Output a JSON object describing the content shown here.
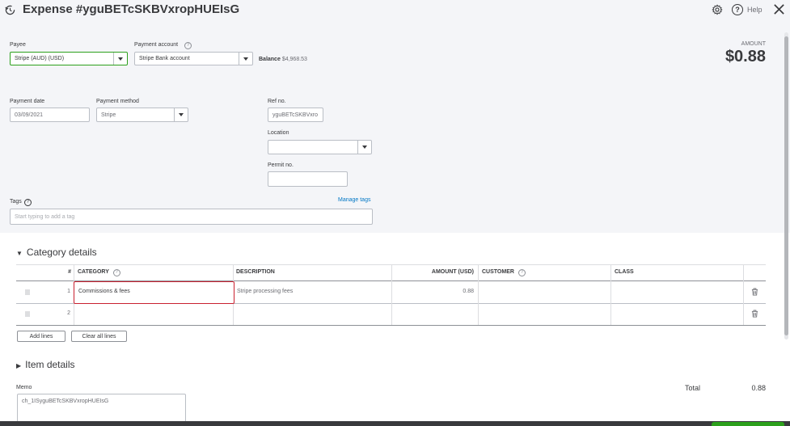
{
  "header": {
    "title": "Expense #yguBETcSKBVxropHUEIsG",
    "help_label": "Help"
  },
  "payee": {
    "label": "Payee",
    "value": "Stripe (AUD) (USD)"
  },
  "payment_account": {
    "label": "Payment account",
    "value": "Stripe Bank account"
  },
  "balance": {
    "label": "Balance",
    "value": "$4,968.53"
  },
  "amount": {
    "label": "AMOUNT",
    "value": "$0.88"
  },
  "payment_date": {
    "label": "Payment date",
    "value": "03/09/2021"
  },
  "payment_method": {
    "label": "Payment method",
    "value": "Stripe"
  },
  "ref_no": {
    "label": "Ref no.",
    "value": "yguBETcSKBVxro"
  },
  "location": {
    "label": "Location",
    "value": ""
  },
  "permit_no": {
    "label": "Permit no.",
    "value": ""
  },
  "tags": {
    "label": "Tags",
    "placeholder": "Start typing to add a tag",
    "manage_label": "Manage tags"
  },
  "category_details": {
    "title": "Category details",
    "columns": [
      "#",
      "CATEGORY",
      "DESCRIPTION",
      "AMOUNT (USD)",
      "CUSTOMER",
      "CLASS"
    ],
    "rows": [
      {
        "num": "1",
        "category": "Commissions & fees",
        "description": "Stripe processing fees",
        "amount": "0.88",
        "customer": "",
        "class": ""
      },
      {
        "num": "2",
        "category": "",
        "description": "",
        "amount": "",
        "customer": "",
        "class": ""
      }
    ],
    "add_lines_label": "Add lines",
    "clear_lines_label": "Clear all lines"
  },
  "item_details": {
    "title": "Item details"
  },
  "memo": {
    "label": "Memo",
    "value": "ch_1ISyguBETcSKBVxropHUEIsG"
  },
  "total": {
    "label": "Total",
    "value": "0.88"
  },
  "colors": {
    "accent": "#2ca01c",
    "link": "#0077c5",
    "highlight": "#c9202f"
  },
  "icons": [
    "history-icon",
    "gear-icon",
    "help-icon",
    "close-icon",
    "info-icon",
    "trash-icon",
    "drag-handle-icon",
    "caret-icon"
  ]
}
